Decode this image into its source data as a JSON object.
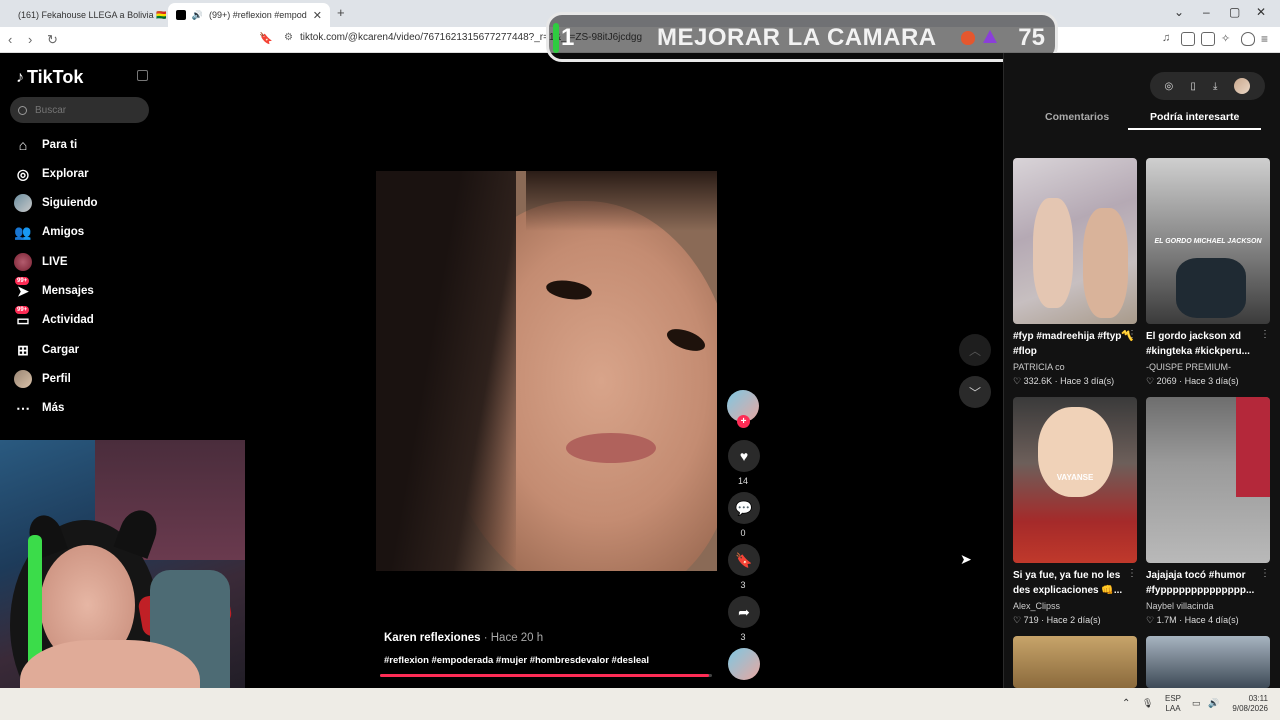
{
  "browser": {
    "tabs": [
      {
        "label": "(161) Fekahouse LLEGA a Bolivia 🇧🇴",
        "active": false
      },
      {
        "label": "(99+) #reflexion #empoderada",
        "active": true
      }
    ],
    "new_tab": "+",
    "url": "tiktok.com/@kcaren4/video/7671621315677277448?_r=1&_t=ZS-98itJ6jcdgg"
  },
  "overlay": {
    "digit": "1",
    "text": "MEJORAR LA CAMARA",
    "count": "75"
  },
  "sidebar": {
    "logo": "TikTok",
    "search_placeholder": "Buscar",
    "items": [
      {
        "label": "Para ti",
        "icon": "home-icon"
      },
      {
        "label": "Explorar",
        "icon": "compass-icon"
      },
      {
        "label": "Siguiendo",
        "icon": "avatar-icon"
      },
      {
        "label": "Amigos",
        "icon": "friends-icon"
      },
      {
        "label": "LIVE",
        "icon": "live-icon"
      },
      {
        "label": "Mensajes",
        "icon": "messages-icon",
        "badge": "99+"
      },
      {
        "label": "Actividad",
        "icon": "activity-icon",
        "badge": "99+"
      },
      {
        "label": "Cargar",
        "icon": "upload-icon"
      },
      {
        "label": "Perfil",
        "icon": "profile-avatar"
      },
      {
        "label": "Más",
        "icon": "more-icon"
      }
    ]
  },
  "video": {
    "author": "Karen reflexiones",
    "time": "· Hace 20 h",
    "tags": "#reflexion #empoderada #mujer #hombresdevalor #desleal",
    "progress": 0.99,
    "likes": "14",
    "comments": "0",
    "saves": "3",
    "shares": "3"
  },
  "right_panel": {
    "tabs": [
      "Comentarios",
      "Podría interesarte"
    ],
    "active_tab": 1,
    "cards": [
      {
        "title": "#fyp #madreehija #ftyp〽️ #flop",
        "author": "PATRICIA co",
        "views": "332.6K",
        "age": "Hace 3 día(s)",
        "overlay": ""
      },
      {
        "title": "El gordo jackson xd #kingteka #kickperu...",
        "author": "-QUISPE PREMIUM-",
        "views": "2069",
        "age": "Hace 3 día(s)",
        "overlay": "EL GORDO MICHAEL JACKSON"
      },
      {
        "title": "Si ya fue, ya fue no les des explicaciones 👊...",
        "author": "Alex_Clipss",
        "views": "719",
        "age": "Hace 2 día(s)",
        "overlay": "VAYANSE"
      },
      {
        "title": "Jajajaja tocó #humor #fypppppppppppppp...",
        "author": "Naybel villacinda",
        "views": "1.7M",
        "age": "Hace 4 día(s)",
        "overlay": ""
      }
    ]
  },
  "taskbar": {
    "lang": "ESP",
    "lang2": "LAA",
    "time": "03:11",
    "date": "9/08/2026"
  }
}
